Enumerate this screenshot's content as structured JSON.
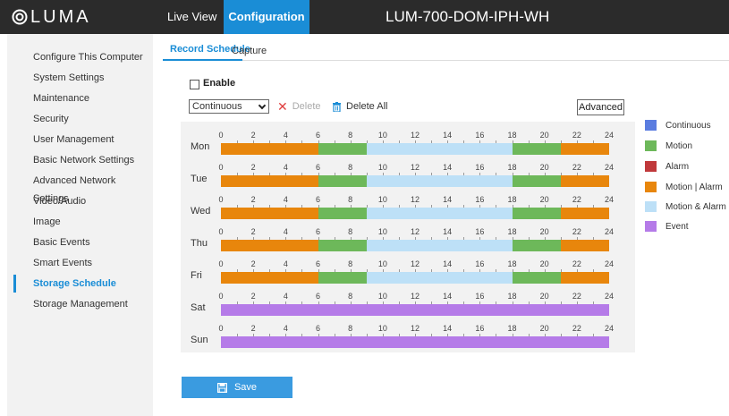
{
  "header": {
    "logo_text": "LUMA",
    "nav_live": "Live View",
    "nav_config": "Configuration",
    "device_name": "LUM-700-DOM-IPH-WH"
  },
  "sidebar": {
    "items": [
      {
        "label": "Configure This Computer",
        "active": false
      },
      {
        "label": "System Settings",
        "active": false
      },
      {
        "label": "Maintenance",
        "active": false
      },
      {
        "label": "Security",
        "active": false
      },
      {
        "label": "User Management",
        "active": false
      },
      {
        "label": "Basic Network Settings",
        "active": false
      },
      {
        "label": "Advanced Network Settings",
        "active": false
      },
      {
        "label": "Video/Audio",
        "active": false
      },
      {
        "label": "Image",
        "active": false
      },
      {
        "label": "Basic Events",
        "active": false
      },
      {
        "label": "Smart Events",
        "active": false
      },
      {
        "label": "Storage Schedule",
        "active": true
      },
      {
        "label": "Storage Management",
        "active": false
      }
    ]
  },
  "tabs": {
    "record": "Record Schedule",
    "capture": "Capture"
  },
  "enable": {
    "label": "Enable",
    "checked": false
  },
  "toolbar": {
    "type_value": "Continuous",
    "delete_label": "Delete",
    "delete_all_label": "Delete All",
    "advanced_label": "Advanced"
  },
  "colors": {
    "continuous": "#5b7de0",
    "motion": "#6db85a",
    "alarm": "#c0393b",
    "motion_or_alarm": "#e8860c",
    "motion_and_alarm": "#bde0f7",
    "event": "#b57be8"
  },
  "legend": [
    {
      "key": "continuous",
      "label": "Continuous"
    },
    {
      "key": "motion",
      "label": "Motion"
    },
    {
      "key": "alarm",
      "label": "Alarm"
    },
    {
      "key": "motion_or_alarm",
      "label": "Motion | Alarm"
    },
    {
      "key": "motion_and_alarm",
      "label": "Motion & Alarm"
    },
    {
      "key": "event",
      "label": "Event"
    }
  ],
  "tick_labels": [
    "0",
    "2",
    "4",
    "6",
    "8",
    "10",
    "12",
    "14",
    "16",
    "18",
    "20",
    "22",
    "24"
  ],
  "schedule": [
    {
      "day": "Mon",
      "segments": [
        {
          "start": 0,
          "end": 6,
          "type": "motion_or_alarm"
        },
        {
          "start": 6,
          "end": 9,
          "type": "motion"
        },
        {
          "start": 9,
          "end": 18,
          "type": "motion_and_alarm"
        },
        {
          "start": 18,
          "end": 21,
          "type": "motion"
        },
        {
          "start": 21,
          "end": 24,
          "type": "motion_or_alarm"
        }
      ]
    },
    {
      "day": "Tue",
      "segments": [
        {
          "start": 0,
          "end": 6,
          "type": "motion_or_alarm"
        },
        {
          "start": 6,
          "end": 9,
          "type": "motion"
        },
        {
          "start": 9,
          "end": 18,
          "type": "motion_and_alarm"
        },
        {
          "start": 18,
          "end": 21,
          "type": "motion"
        },
        {
          "start": 21,
          "end": 24,
          "type": "motion_or_alarm"
        }
      ]
    },
    {
      "day": "Wed",
      "segments": [
        {
          "start": 0,
          "end": 6,
          "type": "motion_or_alarm"
        },
        {
          "start": 6,
          "end": 9,
          "type": "motion"
        },
        {
          "start": 9,
          "end": 18,
          "type": "motion_and_alarm"
        },
        {
          "start": 18,
          "end": 21,
          "type": "motion"
        },
        {
          "start": 21,
          "end": 24,
          "type": "motion_or_alarm"
        }
      ]
    },
    {
      "day": "Thu",
      "segments": [
        {
          "start": 0,
          "end": 6,
          "type": "motion_or_alarm"
        },
        {
          "start": 6,
          "end": 9,
          "type": "motion"
        },
        {
          "start": 9,
          "end": 18,
          "type": "motion_and_alarm"
        },
        {
          "start": 18,
          "end": 21,
          "type": "motion"
        },
        {
          "start": 21,
          "end": 24,
          "type": "motion_or_alarm"
        }
      ]
    },
    {
      "day": "Fri",
      "segments": [
        {
          "start": 0,
          "end": 6,
          "type": "motion_or_alarm"
        },
        {
          "start": 6,
          "end": 9,
          "type": "motion"
        },
        {
          "start": 9,
          "end": 18,
          "type": "motion_and_alarm"
        },
        {
          "start": 18,
          "end": 21,
          "type": "motion"
        },
        {
          "start": 21,
          "end": 24,
          "type": "motion_or_alarm"
        }
      ]
    },
    {
      "day": "Sat",
      "segments": [
        {
          "start": 0,
          "end": 24,
          "type": "event"
        }
      ]
    },
    {
      "day": "Sun",
      "segments": [
        {
          "start": 0,
          "end": 24,
          "type": "event"
        }
      ]
    }
  ],
  "save_label": "Save"
}
